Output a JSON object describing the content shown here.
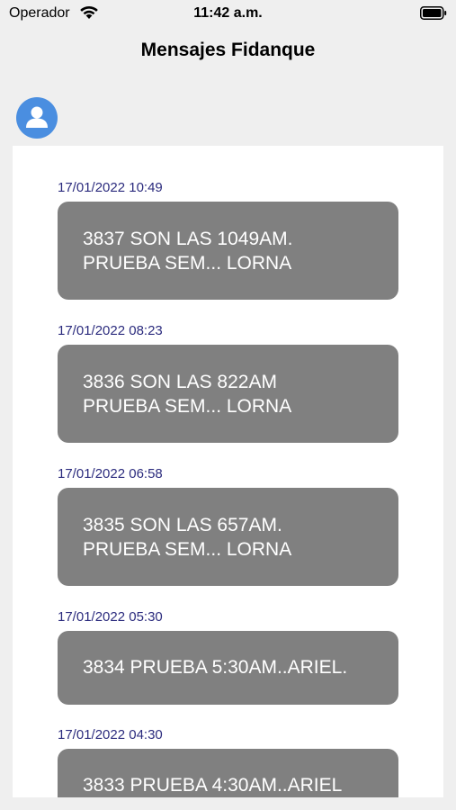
{
  "status_bar": {
    "carrier": "Operador",
    "time": "11:42 a.m.",
    "wifi_icon": "wifi-icon",
    "battery_icon": "battery-icon"
  },
  "nav": {
    "title": "Mensajes Fidanque"
  },
  "profile": {
    "icon": "user-avatar-icon",
    "color": "#4a8ee0"
  },
  "messages": [
    {
      "date": "17/01/2022 10:49",
      "text": "3837 SON LAS 1049AM.\nPRUEBA SEM... LORNA"
    },
    {
      "date": "17/01/2022 08:23",
      "text": "3836 SON LAS 822AM\nPRUEBA SEM... LORNA"
    },
    {
      "date": "17/01/2022 06:58",
      "text": "3835 SON LAS 657AM.\nPRUEBA SEM... LORNA"
    },
    {
      "date": "17/01/2022 05:30",
      "text": "3834 PRUEBA 5:30AM..ARIEL."
    },
    {
      "date": "17/01/2022 04:30",
      "text": "3833 PRUEBA 4:30AM..ARIEL"
    }
  ],
  "colors": {
    "bubble": "#808080",
    "date_text": "#2c2c7e",
    "background": "#efefef"
  }
}
